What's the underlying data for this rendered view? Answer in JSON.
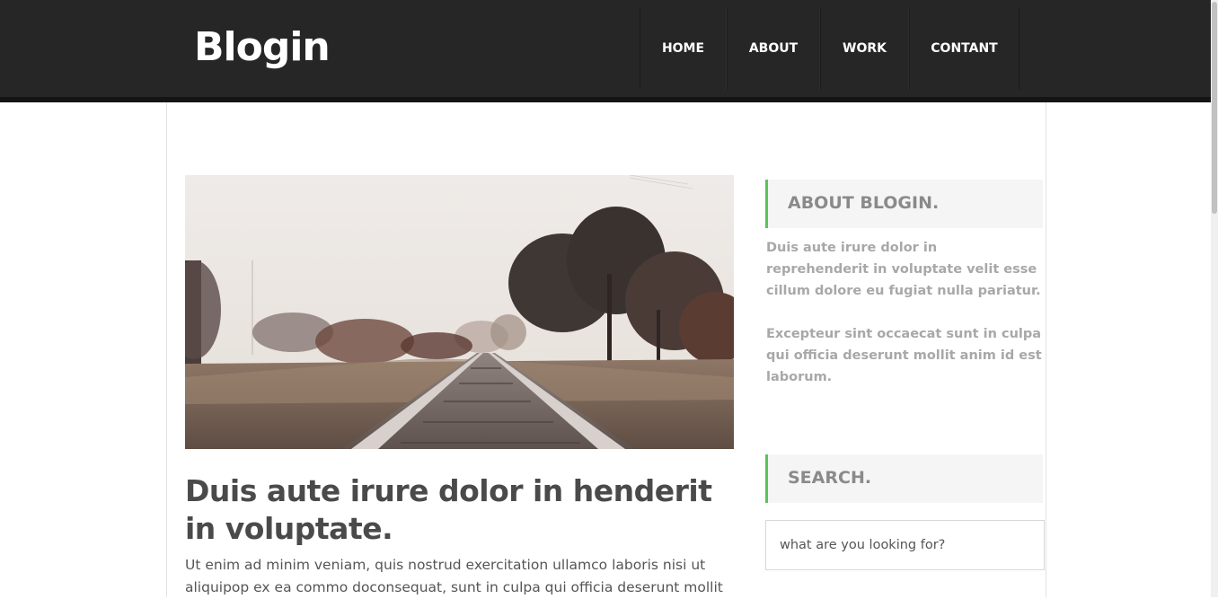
{
  "header": {
    "logo": "Blogin",
    "nav": [
      {
        "label": "HOME"
      },
      {
        "label": "ABOUT"
      },
      {
        "label": "WORK"
      },
      {
        "label": "CONTANT"
      }
    ]
  },
  "post": {
    "image_alt": "railway-tracks-photo",
    "title": "Duis aute irure dolor in henderit in voluptate.",
    "body": "Ut enim ad minim veniam, quis nostrud exercitation ullamco laboris nisi ut aliquipop ex ea commo doconsequat, sunt in culpa qui officia deserunt mollit"
  },
  "sidebar": {
    "about": {
      "heading": "ABOUT BLOGIN.",
      "paragraphs": [
        "Duis aute irure dolor in reprehenderit in voluptate velit esse cillum dolore eu fugiat nulla pariatur.",
        "Excepteur sint occaecat sunt in culpa qui officia deserunt mollit anim id est laborum."
      ]
    },
    "search": {
      "heading": "SEARCH.",
      "placeholder": "what are you looking for?"
    }
  },
  "colors": {
    "header_bg": "#262626",
    "accent": "#5cc35a"
  }
}
